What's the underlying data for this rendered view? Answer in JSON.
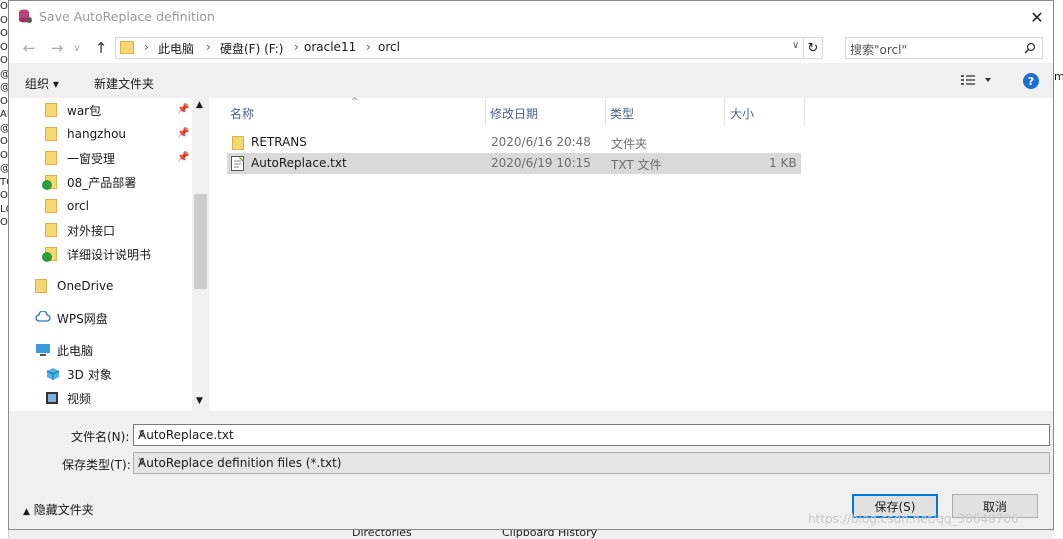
{
  "window": {
    "title": "Save AutoReplace definition"
  },
  "nav": {
    "crumbs": [
      "此电脑",
      "硬盘(F) (F:)",
      "oracle11",
      "orcl"
    ],
    "search_placeholder": "搜索\"orcl\""
  },
  "toolbar": {
    "organize": "组织 ▾",
    "new_folder": "新建文件夹"
  },
  "sidebar": {
    "items": [
      {
        "label": "war包",
        "icon": "folder-icon",
        "pinned": true
      },
      {
        "label": "hangzhou",
        "icon": "folder-icon",
        "pinned": true
      },
      {
        "label": "一窗受理",
        "icon": "folder-icon",
        "pinned": true
      },
      {
        "label": "08_产品部署",
        "icon": "synced-folder-icon",
        "pinned": false
      },
      {
        "label": "orcl",
        "icon": "folder-icon",
        "pinned": false
      },
      {
        "label": "对外接口",
        "icon": "folder-icon",
        "pinned": false
      },
      {
        "label": "详细设计说明书",
        "icon": "synced-folder-icon",
        "pinned": false
      },
      {
        "label": "OneDrive",
        "icon": "folder-icon",
        "pinned": false
      },
      {
        "label": "WPS网盘",
        "icon": "cloud-icon",
        "pinned": false
      },
      {
        "label": "此电脑",
        "icon": "computer-icon",
        "pinned": false
      },
      {
        "label": "3D 对象",
        "icon": "3d-objects-icon",
        "pinned": false
      },
      {
        "label": "视频",
        "icon": "video-icon",
        "pinned": false
      }
    ]
  },
  "files": {
    "columns": [
      "名称",
      "修改日期",
      "类型",
      "大小"
    ],
    "rows": [
      {
        "name": "RETRANS",
        "date": "2020/6/16 20:48",
        "type": "文件夹",
        "size": "",
        "icon": "folder-icon"
      },
      {
        "name": "AutoReplace.txt",
        "date": "2020/6/19 10:15",
        "type": "TXT 文件",
        "size": "1 KB",
        "icon": "text-file-icon"
      }
    ]
  },
  "form": {
    "filename_label": "文件名(N):",
    "filename_value": "AutoReplace.txt",
    "filetype_label": "保存类型(T):",
    "filetype_value": "AutoReplace definition files (*.txt)"
  },
  "footer": {
    "hide_folders": "隐藏文件夹",
    "save": "保存(S)",
    "cancel": "取消"
  },
  "background": {
    "left_chars": [
      "O",
      "O",
      "O",
      "O",
      "O",
      "@",
      "@",
      "O",
      "AR",
      "@",
      "OI",
      "O",
      "@",
      "TO",
      "O",
      "LC",
      "OI"
    ],
    "right_char": "m",
    "bottom_left": "Directories",
    "bottom_right": "Clipboard History"
  },
  "watermark": "https://blog.csdn.net/qq_38648706"
}
